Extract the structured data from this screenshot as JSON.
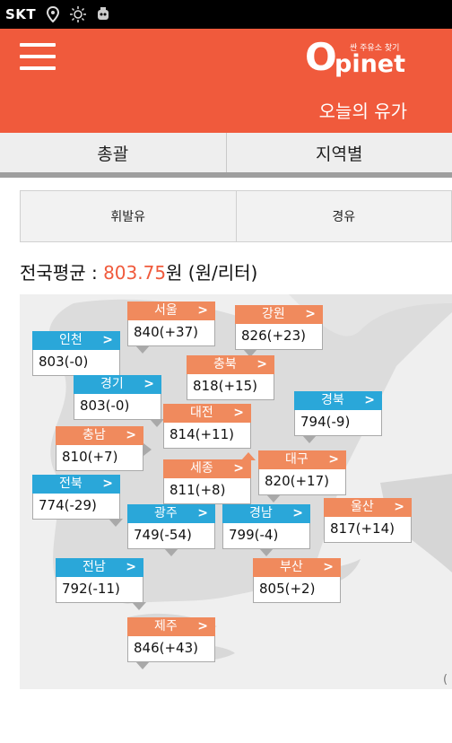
{
  "status_bar": {
    "carrier": "SKT",
    "icons": [
      "location-pin-icon",
      "weather-sun-icon",
      "notification-icon"
    ]
  },
  "header": {
    "menu_icon": "hamburger-menu-icon",
    "logo": {
      "tagline": "싼 주유소 찾기",
      "brand_first": "O",
      "brand_rest": "pinet"
    },
    "subtitle": "오늘의 유가"
  },
  "main_tabs": [
    {
      "label": "총괄"
    },
    {
      "label": "지역별"
    }
  ],
  "fuel_tabs": [
    {
      "label": "휘발유"
    },
    {
      "label": "경유"
    }
  ],
  "average": {
    "label": "전국평균 : ",
    "value": "803.75",
    "unit": "원 (원/리터)"
  },
  "colors": {
    "header": "#f05a3c",
    "orange_card": "#f08a5d",
    "blue_card": "#2aa7d9",
    "accent": "#f05a3c"
  },
  "regions": [
    {
      "name": "서울",
      "price": "840(+37)",
      "color": "orange"
    },
    {
      "name": "인천",
      "price": "803(-0)",
      "color": "blue"
    },
    {
      "name": "강원",
      "price": "826(+23)",
      "color": "orange"
    },
    {
      "name": "충북",
      "price": "818(+15)",
      "color": "orange"
    },
    {
      "name": "경기",
      "price": "803(-0)",
      "color": "blue"
    },
    {
      "name": "경북",
      "price": "794(-9)",
      "color": "blue"
    },
    {
      "name": "대전",
      "price": "814(+11)",
      "color": "orange"
    },
    {
      "name": "충남",
      "price": "810(+7)",
      "color": "orange"
    },
    {
      "name": "대구",
      "price": "820(+17)",
      "color": "orange"
    },
    {
      "name": "세종",
      "price": "811(+8)",
      "color": "orange"
    },
    {
      "name": "전북",
      "price": "774(-29)",
      "color": "blue"
    },
    {
      "name": "광주",
      "price": "749(-54)",
      "color": "blue"
    },
    {
      "name": "경남",
      "price": "799(-4)",
      "color": "blue"
    },
    {
      "name": "울산",
      "price": "817(+14)",
      "color": "orange"
    },
    {
      "name": "전남",
      "price": "792(-11)",
      "color": "blue"
    },
    {
      "name": "부산",
      "price": "805(+2)",
      "color": "orange"
    },
    {
      "name": "제주",
      "price": "846(+43)",
      "color": "orange"
    }
  ],
  "map_edge_mark": "("
}
